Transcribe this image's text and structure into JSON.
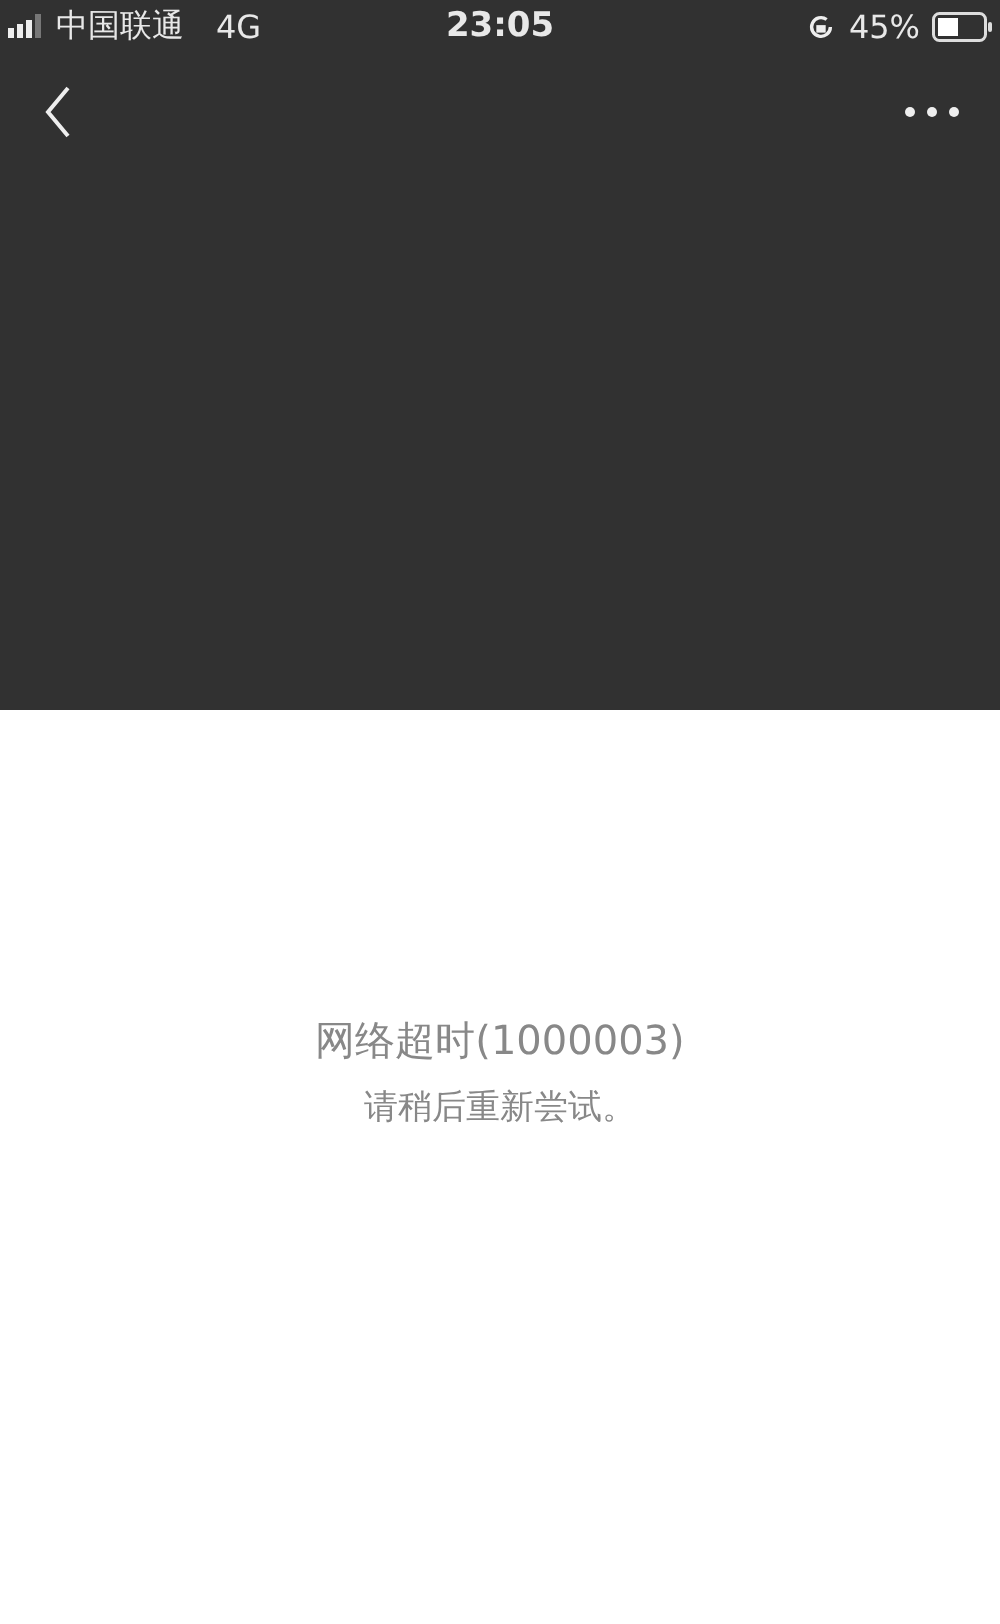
{
  "status_bar": {
    "carrier": "中国联通",
    "network": "4G",
    "time": "23:05",
    "battery": "45%"
  },
  "error": {
    "title": "网络超时(1000003)",
    "message": "请稍后重新尝试。"
  }
}
